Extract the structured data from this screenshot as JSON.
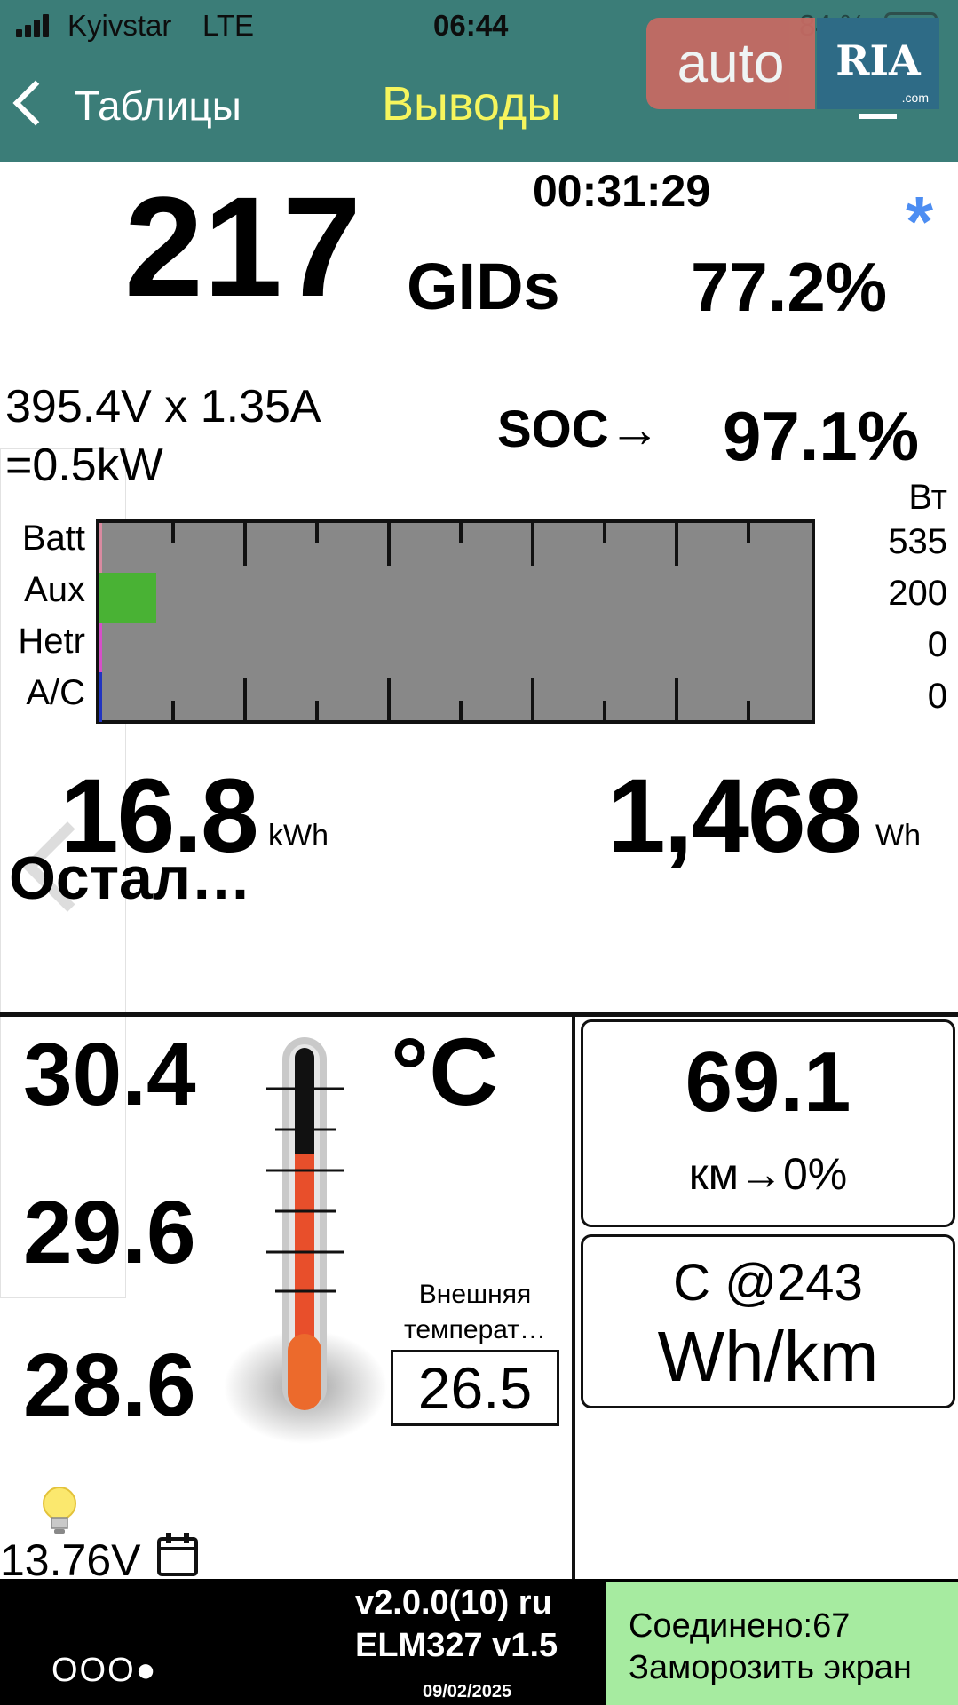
{
  "status_bar": {
    "carrier": "Kyivstar",
    "network": "LTE",
    "time": "06:44",
    "battery": "84 %"
  },
  "nav": {
    "back_label": "Таблицы",
    "title": "Выводы"
  },
  "watermark": {
    "auto": "auto",
    "ria": "RIA",
    "domain": ".com"
  },
  "top_panel": {
    "gids": "217",
    "gids_unit": "GIDs",
    "timer": "00:31:29",
    "asterisk": "*",
    "gids_percent": "77.2%",
    "voltage_current": "395.4V x 1.35A",
    "power": "=0.5kW",
    "soc_label": "SOC→",
    "soc_value": "97.1%"
  },
  "power_bars": {
    "unit": "Вт",
    "max_watts": 6000,
    "rows": [
      {
        "label": "Batt",
        "value": "535",
        "watts": 535,
        "color": "#d98aa0"
      },
      {
        "label": "Aux",
        "value": "200",
        "watts": 200,
        "color": "#49b234"
      },
      {
        "label": "Hetr",
        "value": "0",
        "watts": 0,
        "color": "#d64fc8"
      },
      {
        "label": "A/C",
        "value": "0",
        "watts": 0,
        "color": "#2234c0"
      }
    ]
  },
  "energy": {
    "remaining": "16.8",
    "remaining_unit": "kWh",
    "used": "1,468",
    "used_unit": "Wh",
    "remaining_label": "Остал…"
  },
  "temperatures": {
    "unit": "°C",
    "values": [
      "30.4",
      "29.6",
      "28.6"
    ],
    "outside_label": "Внешняя температ…",
    "outside_value": "26.5",
    "colors": {
      "mercury": "#e84f2b",
      "bulb": "#ec6a2c",
      "empty": "#111111"
    }
  },
  "aux_battery": {
    "voltage": "13.76V"
  },
  "range": {
    "value": "69.1",
    "label": "км→0%"
  },
  "efficiency": {
    "line1": "C @243",
    "line2": "Wh/km"
  },
  "footer": {
    "page_dots": "OOO●",
    "version": "v2.0.0(10) ru",
    "adapter": "ELM327 v1.5",
    "date": "09/02/2025",
    "connection": "Соединено:67",
    "freeze": "Заморозить экран"
  }
}
